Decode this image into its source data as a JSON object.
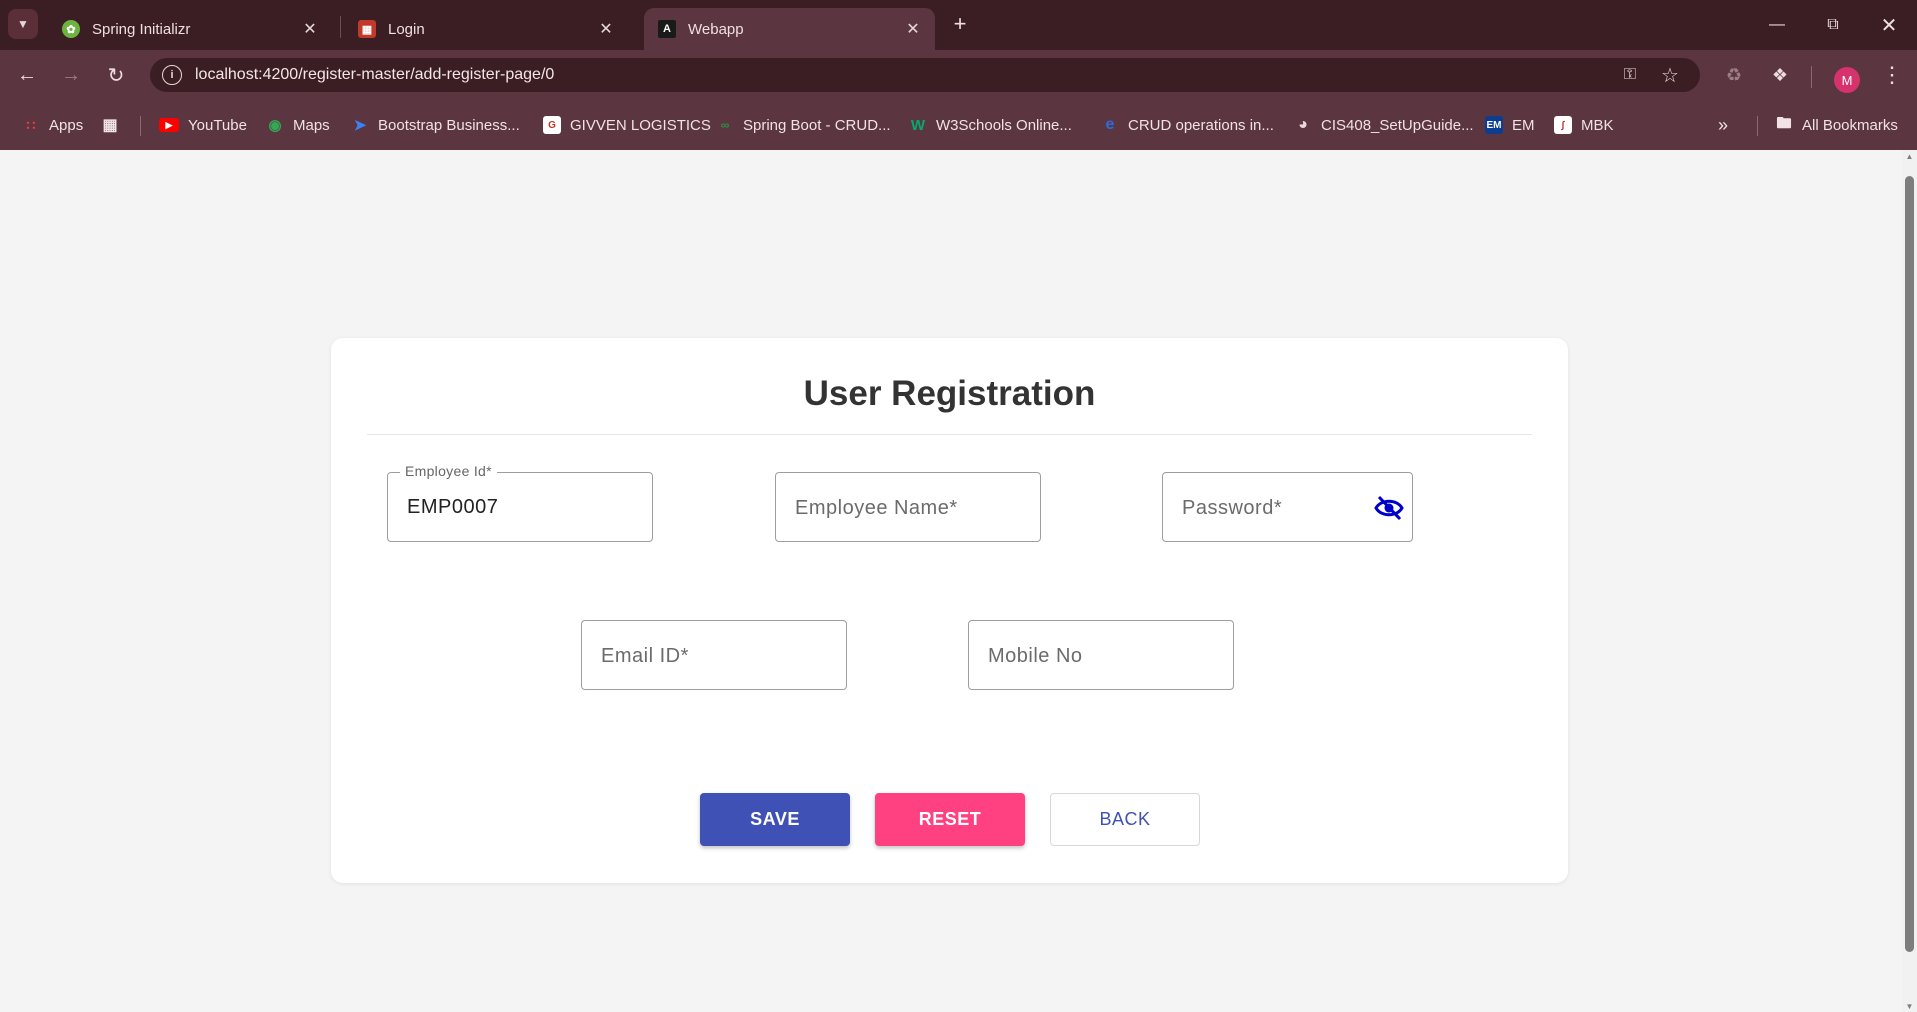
{
  "browser": {
    "tabs": [
      {
        "title": "Spring Initializr",
        "icon": "spring-leaf-icon",
        "active": false
      },
      {
        "title": "Login",
        "icon": "grid-app-icon",
        "active": false
      },
      {
        "title": "Webapp",
        "icon": "angular-icon",
        "active": true
      }
    ],
    "url": "localhost:4200/register-master/add-register-page/0",
    "profile_initial": "M",
    "bookmarks": [
      {
        "label": "Apps",
        "icon": "apps-grid-icon"
      },
      {
        "label": "YouTube",
        "icon": "youtube-icon"
      },
      {
        "label": "Maps",
        "icon": "maps-pin-icon"
      },
      {
        "label": "Bootstrap Business...",
        "icon": "bootstrap-icon"
      },
      {
        "label": "GIVVEN LOGISTICS",
        "icon": "givven-icon"
      },
      {
        "label": "Spring Boot - CRUD...",
        "icon": "gfg-icon"
      },
      {
        "label": "W3Schools Online...",
        "icon": "w3schools-icon"
      },
      {
        "label": "CRUD operations in...",
        "icon": "edge-icon"
      },
      {
        "label": "CIS408_SetUpGuide...",
        "icon": "globe-icon"
      },
      {
        "label": "EM",
        "icon": "em-icon"
      },
      {
        "label": "MBK",
        "icon": "mbk-icon"
      }
    ],
    "all_bookmarks_label": "All Bookmarks"
  },
  "form": {
    "title": "User Registration",
    "employee_id": {
      "label": "Employee Id*",
      "value": "EMP0007"
    },
    "employee_name": {
      "placeholder": "Employee Name*"
    },
    "password": {
      "placeholder": "Password*"
    },
    "email": {
      "placeholder": "Email ID*"
    },
    "mobile": {
      "placeholder": "Mobile No"
    },
    "buttons": {
      "save": "SAVE",
      "reset": "RESET",
      "back": "BACK"
    }
  },
  "colors": {
    "primary": "#3f51b5",
    "accent": "#ff4081",
    "chrome": "#5b3540",
    "tabstrip": "#3b1e24",
    "eye_icon": "#0000cc"
  }
}
